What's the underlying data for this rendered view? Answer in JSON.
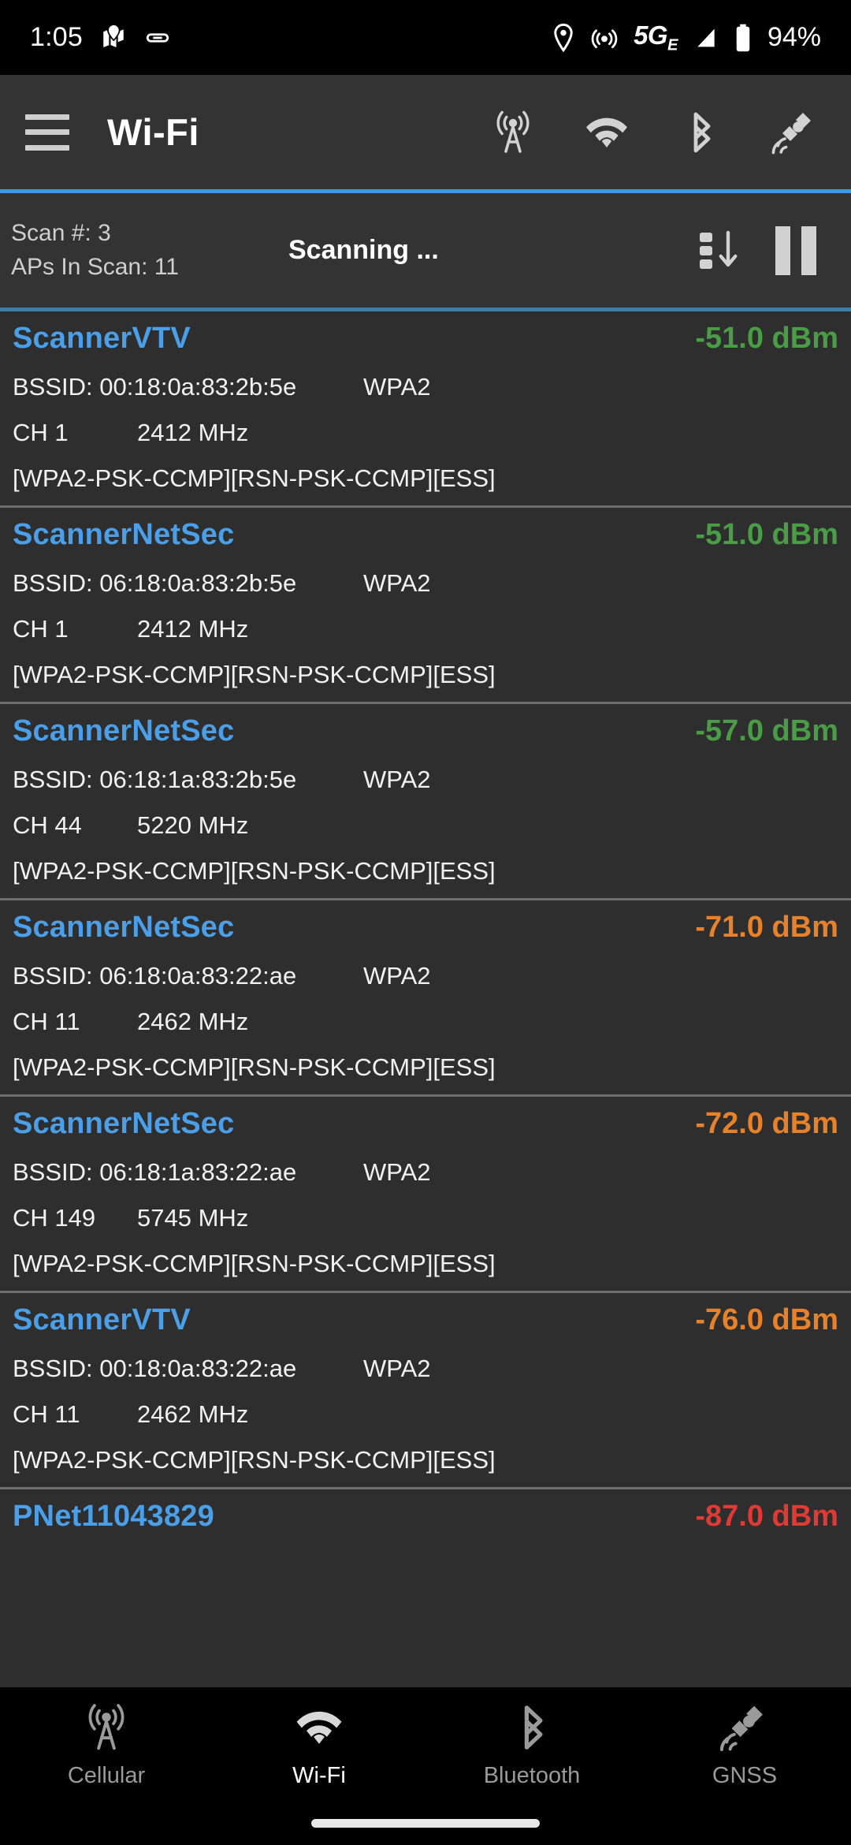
{
  "status_bar": {
    "time": "1:05",
    "battery_percent": "94%",
    "network_type": "5G",
    "network_suffix": "E",
    "icons": [
      "map-icon",
      "link-icon",
      "location-pin-icon",
      "hotspot-icon",
      "signal-icon",
      "battery-icon"
    ]
  },
  "toolbar": {
    "title": "Wi-Fi",
    "menu_icon": "hamburger-menu-icon",
    "actions": [
      "cell-tower-icon",
      "wifi-icon",
      "bluetooth-icon",
      "satellite-icon"
    ],
    "accent_color": "#3d9ae8"
  },
  "scan_status": {
    "scan_number_label": "Scan #: 3",
    "aps_in_scan_label": "APs In Scan: 11",
    "state_label": "Scanning ...",
    "sort_button": "sort-descending-icon",
    "pause_button": "pause-icon"
  },
  "colors": {
    "ssid": "#4a9fe8",
    "level_good": "#4a9c46",
    "level_medium": "#e8822a",
    "level_weak": "#e03a34",
    "background": "#2e2e2e",
    "toolbar_bg": "#333333"
  },
  "access_points": [
    {
      "ssid": "ScannerVTV",
      "level": "-51.0 dBm",
      "level_class": "lvl-good",
      "bssid": "BSSID: 00:18:0a:83:2b:5e",
      "security": "WPA2",
      "channel": "CH 1",
      "frequency": "2412 MHz",
      "capabilities": "[WPA2-PSK-CCMP][RSN-PSK-CCMP][ESS]"
    },
    {
      "ssid": "ScannerNetSec",
      "level": "-51.0 dBm",
      "level_class": "lvl-good",
      "bssid": "BSSID: 06:18:0a:83:2b:5e",
      "security": "WPA2",
      "channel": "CH 1",
      "frequency": "2412 MHz",
      "capabilities": "[WPA2-PSK-CCMP][RSN-PSK-CCMP][ESS]"
    },
    {
      "ssid": "ScannerNetSec",
      "level": "-57.0 dBm",
      "level_class": "lvl-good",
      "bssid": "BSSID: 06:18:1a:83:2b:5e",
      "security": "WPA2",
      "channel": "CH 44",
      "frequency": "5220 MHz",
      "capabilities": "[WPA2-PSK-CCMP][RSN-PSK-CCMP][ESS]"
    },
    {
      "ssid": "ScannerNetSec",
      "level": "-71.0 dBm",
      "level_class": "lvl-mid",
      "bssid": "BSSID: 06:18:0a:83:22:ae",
      "security": "WPA2",
      "channel": "CH 11",
      "frequency": "2462 MHz",
      "capabilities": "[WPA2-PSK-CCMP][RSN-PSK-CCMP][ESS]"
    },
    {
      "ssid": "ScannerNetSec",
      "level": "-72.0 dBm",
      "level_class": "lvl-mid",
      "bssid": "BSSID: 06:18:1a:83:22:ae",
      "security": "WPA2",
      "channel": "CH 149",
      "frequency": "5745 MHz",
      "capabilities": "[WPA2-PSK-CCMP][RSN-PSK-CCMP][ESS]"
    },
    {
      "ssid": "ScannerVTV",
      "level": "-76.0 dBm",
      "level_class": "lvl-mid",
      "bssid": "BSSID: 00:18:0a:83:22:ae",
      "security": "WPA2",
      "channel": "CH 11",
      "frequency": "2462 MHz",
      "capabilities": "[WPA2-PSK-CCMP][RSN-PSK-CCMP][ESS]"
    },
    {
      "ssid": "PNet11043829",
      "level": "-87.0 dBm",
      "level_class": "lvl-bad",
      "bssid": "",
      "security": "",
      "channel": "",
      "frequency": "",
      "capabilities": "",
      "truncated": true
    }
  ],
  "bottom_nav": {
    "items": [
      {
        "label": "Cellular",
        "icon": "cell-tower-icon",
        "active": false
      },
      {
        "label": "Wi-Fi",
        "icon": "wifi-icon",
        "active": true
      },
      {
        "label": "Bluetooth",
        "icon": "bluetooth-icon",
        "active": false
      },
      {
        "label": "GNSS",
        "icon": "satellite-icon",
        "active": false
      }
    ]
  }
}
